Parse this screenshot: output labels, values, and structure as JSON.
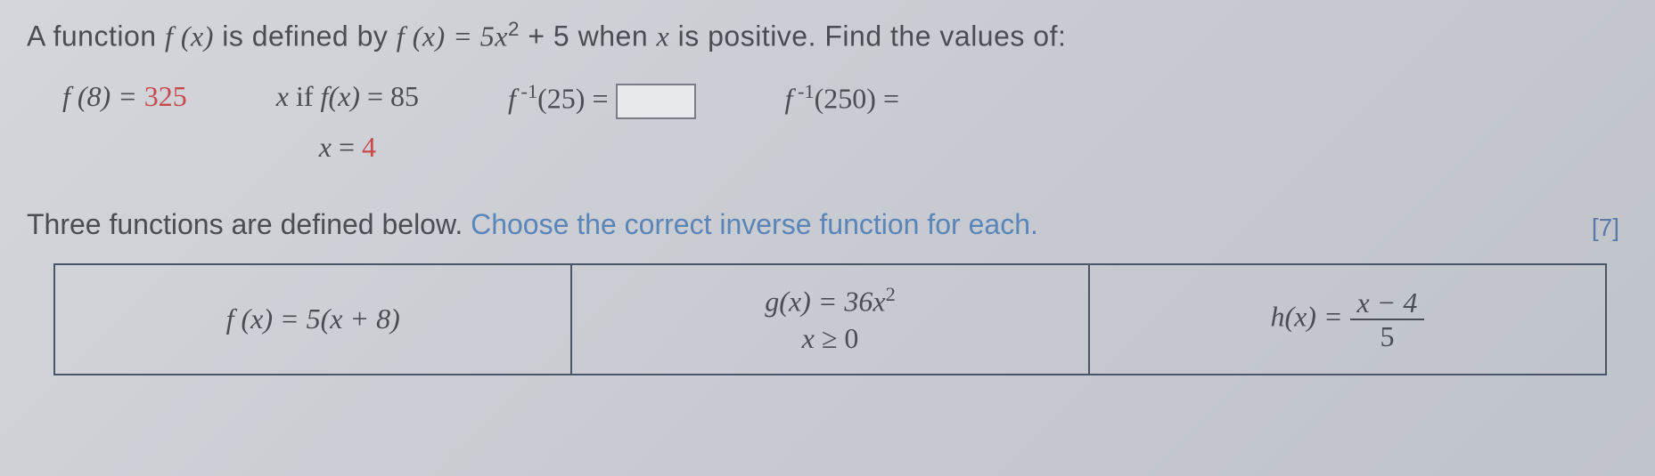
{
  "question": {
    "prefix": "A function ",
    "fx": "f (x)",
    "middle": " is defined by  ",
    "definition_lhs": "f (x) = 5x",
    "definition_exp": "2",
    "definition_rhs": " + 5 when ",
    "xvar": "x",
    "suffix": " is positive. Find the values of:"
  },
  "answers": {
    "a1_lhs": "f (8) = ",
    "a1_val": "325",
    "a2_line1_pre": "x",
    "a2_line1_mid": " if ",
    "a2_line1_fx": "f(x)",
    "a2_line1_eq": " = 85",
    "a2_line2_pre": "x",
    "a2_line2_eq": " =  ",
    "a2_line2_val": "4",
    "a3_f": "f",
    "a3_exp": " -1",
    "a3_arg": "(25) = ",
    "a3_input": "",
    "a4_f": "f",
    "a4_exp": " -1",
    "a4_arg": "(250) ="
  },
  "marks": "[7]",
  "instruction": {
    "black": "Three functions are defined below. ",
    "blue": "Choose the correct inverse function for each."
  },
  "table": {
    "c1": "f (x) = 5(x + 8)",
    "c2_top_lhs": "g(x) = 36x",
    "c2_top_exp": "2",
    "c2_bot_var": "x",
    "c2_bot_op": " ≥ 0",
    "c3_lhs": "h(x) = ",
    "c3_num": "x − 4",
    "c3_den": "5"
  }
}
